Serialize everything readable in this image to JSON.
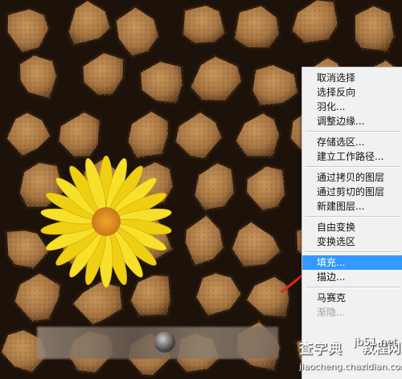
{
  "menu": {
    "groups": [
      [
        {
          "label": "取消选择",
          "state": "normal"
        },
        {
          "label": "选择反向",
          "state": "normal"
        },
        {
          "label": "羽化...",
          "state": "normal"
        },
        {
          "label": "调整边缘...",
          "state": "normal"
        }
      ],
      [
        {
          "label": "存储选区...",
          "state": "normal"
        },
        {
          "label": "建立工作路径...",
          "state": "normal"
        }
      ],
      [
        {
          "label": "通过拷贝的图层",
          "state": "normal"
        },
        {
          "label": "通过剪切的图层",
          "state": "normal"
        },
        {
          "label": "新建图层...",
          "state": "normal"
        }
      ],
      [
        {
          "label": "自由变换",
          "state": "normal"
        },
        {
          "label": "变换选区",
          "state": "normal"
        }
      ],
      [
        {
          "label": "填充...",
          "state": "highlighted"
        },
        {
          "label": "描边...",
          "state": "normal"
        }
      ],
      [
        {
          "label": "马赛克",
          "state": "normal"
        },
        {
          "label": "渐隐...",
          "state": "disabled"
        }
      ]
    ]
  },
  "annotation": {
    "color": "#e8261b",
    "points_to": "填充..."
  },
  "colors": {
    "menu_bg": "#f1f1f1",
    "highlight": "#3399ff",
    "soil": "#a87a46",
    "crack": "#2a1a0e",
    "petal": "#f4d81a"
  },
  "watermark": {
    "main": "查字典",
    "brand": "教程网",
    "site": "jb51.net",
    "url": "jiaocheng.chazidian.com"
  }
}
